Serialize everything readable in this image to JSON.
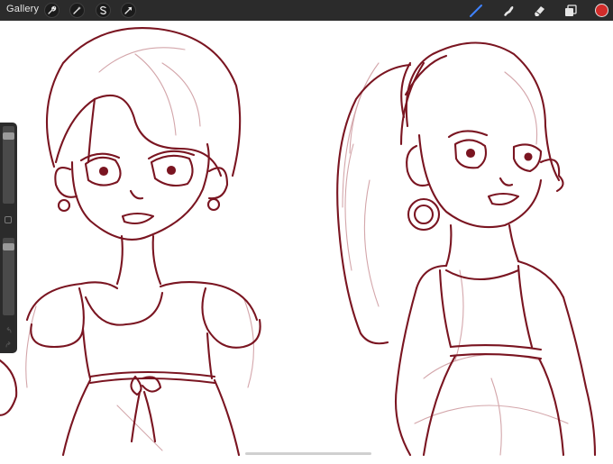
{
  "app": {
    "gallery_label": "Gallery"
  },
  "toolbar_left": {
    "buttons": [
      "actions-wrench-icon",
      "adjustments-wand-icon",
      "selection-s-icon",
      "transform-arrow-icon"
    ]
  },
  "toolbar_right": {
    "tools": [
      "brush-icon",
      "smudge-icon",
      "eraser-icon",
      "layers-icon"
    ],
    "active_tool": "brush-icon",
    "active_color": "#d22c2a",
    "active_tool_color": "#3f83ff"
  },
  "sidebar": {
    "brush_size": 0.93,
    "brush_opacity": 0.95
  },
  "canvas": {
    "stroke_color": "#7a1521",
    "sketch_color": "#c0878d",
    "content": "sketch-of-two-girls"
  }
}
